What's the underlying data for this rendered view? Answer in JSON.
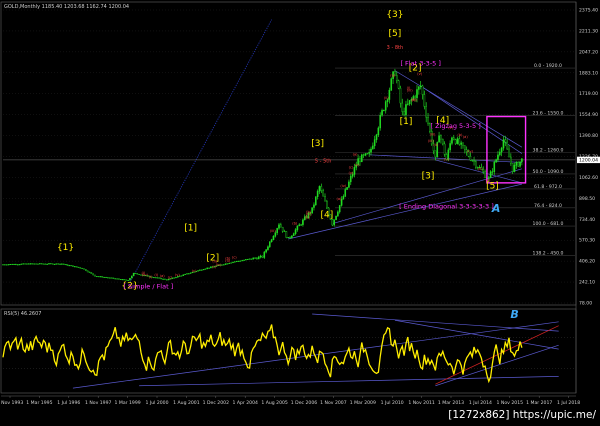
{
  "header": "GOLD,Monthly  1185.40 1203.68 1162.74 1200.04",
  "rsi_label": "RSI(5) 46.2607",
  "watermark": "[1272x862]  https://upic.me/",
  "colors": {
    "background": "#000000",
    "candles": "#22dd22",
    "rsi": "#ffee00",
    "grid": "#2a2a2a",
    "fib": "#3a3a3a",
    "trendline": "#5a5ad0",
    "box": "#ff33ff",
    "wave_major": "#ffee00",
    "wave_minor": "#ff4444",
    "wave_magenta": "#ff33ff",
    "wave_cyan": "#3fa9f5"
  },
  "chart_data": [
    {
      "type": "candlestick",
      "title": "GOLD,Monthly",
      "last_bar": {
        "open": 1185.4,
        "high": 1203.68,
        "low": 1162.74,
        "close": 1200.04
      },
      "current_price_label": "1200.04",
      "y_ticks": [
        "2375.40",
        "2211.30",
        "2047.20",
        "1883.10",
        "1719.00",
        "1554.90",
        "1390.80",
        "1226.70",
        "1062.60",
        "898.50",
        "734.40",
        "570.30",
        "406.20",
        "242.10",
        "78.00"
      ],
      "fib_levels": [
        {
          "label": "0.0 - 1920.0",
          "value": 1920
        },
        {
          "label": "23.6 - 1550.0",
          "value": 1550
        },
        {
          "label": "38.2 - 1260.0",
          "value": 1260
        },
        {
          "label": "50.0 - 1090.0",
          "value": 1090
        },
        {
          "label": "61.8 - 972.0",
          "value": 972
        },
        {
          "label": "76.4 - 824.0",
          "value": 824
        },
        {
          "label": "100.0 - 681.0",
          "value": 681
        },
        {
          "label": "138.2 - 450.0",
          "value": 450
        }
      ],
      "x_labels": [
        "1 Nov 1993",
        "1 Mar 1995",
        "1 Jul 1996",
        "1 Nov 1997",
        "1 Mar 1999",
        "1 Jul 2000",
        "1 Aug 2001",
        "1 Dec 2002",
        "1 Apr 2004",
        "1 Aug 2005",
        "1 Dec 2006",
        "1 Nov 2007",
        "1 Mar 2009",
        "1 Jul 2010",
        "1 Nov 2011",
        "1 Mar 2013",
        "1 Jul 2014",
        "1 Nov 2015",
        "1 Mar 2017",
        "1 Jul 2018"
      ],
      "series": [
        {
          "name": "GOLD",
          "anchors": [
            {
              "date": "1993-11",
              "value": 380
            },
            {
              "date": "1995-03",
              "value": 385
            },
            {
              "date": "1996-07",
              "value": 385
            },
            {
              "date": "1997-06",
              "value": 350
            },
            {
              "date": "1998-01",
              "value": 290
            },
            {
              "date": "1999-07",
              "value": 255
            },
            {
              "date": "1999-10",
              "value": 310
            },
            {
              "date": "2001-04",
              "value": 260
            },
            {
              "date": "2002-12",
              "value": 345
            },
            {
              "date": "2004-04",
              "value": 400
            },
            {
              "date": "2005-08",
              "value": 440
            },
            {
              "date": "2006-05",
              "value": 700
            },
            {
              "date": "2006-10",
              "value": 580
            },
            {
              "date": "2007-11",
              "value": 810
            },
            {
              "date": "2008-03",
              "value": 990
            },
            {
              "date": "2008-10",
              "value": 700
            },
            {
              "date": "2009-12",
              "value": 1200
            },
            {
              "date": "2010-06",
              "value": 1240
            },
            {
              "date": "2011-08",
              "value": 1900
            },
            {
              "date": "2011-12",
              "value": 1560
            },
            {
              "date": "2012-10",
              "value": 1780
            },
            {
              "date": "2013-06",
              "value": 1200
            },
            {
              "date": "2013-08",
              "value": 1420
            },
            {
              "date": "2013-12",
              "value": 1200
            },
            {
              "date": "2014-03",
              "value": 1390
            },
            {
              "date": "2015-11",
              "value": 1050
            },
            {
              "date": "2016-07",
              "value": 1360
            },
            {
              "date": "2016-12",
              "value": 1130
            },
            {
              "date": "2017-05",
              "value": 1200
            }
          ]
        }
      ]
    },
    {
      "type": "line",
      "title": "RSI(5) 46.2607",
      "ylim": [
        0,
        100
      ],
      "levels": [
        70,
        30
      ],
      "series": [
        {
          "name": "RSI(5)"
        }
      ]
    }
  ],
  "annotations": {
    "major": [
      {
        "text": "{3}",
        "date": "2011-08",
        "value": 2320
      },
      {
        "text": "[5]",
        "date": "2011-08",
        "value": 2170
      },
      {
        "text": "{1}",
        "date": "1996-09",
        "value": 495
      },
      {
        "text": "{2}",
        "date": "1999-08",
        "value": 190
      },
      {
        "text": "[1]",
        "date": "2002-05",
        "value": 645
      },
      {
        "text": "[2]",
        "date": "2003-05",
        "value": 410
      },
      {
        "text": "[3]",
        "date": "2008-02",
        "value": 1310
      },
      {
        "text": "[4]",
        "date": "2008-07",
        "value": 750
      },
      {
        "text": "[1]",
        "date": "2012-02",
        "value": 1480
      },
      {
        "text": "[2]",
        "date": "2012-07",
        "value": 1900
      },
      {
        "text": "[4]",
        "date": "2013-10",
        "value": 1490
      },
      {
        "text": "[3]",
        "date": "2013-02",
        "value": 1055
      },
      {
        "text": "[5]",
        "date": "2016-01",
        "value": 975
      }
    ],
    "magenta": [
      {
        "text": "[ Flat 3-3-5 ]",
        "date": "2012-10",
        "value": 1940
      },
      {
        "text": "[ Zigzag 5-3-5 ]",
        "date": "2014-05",
        "value": 1450
      },
      {
        "text": "[ Ending Diagonal 3-3-3-3-3 ]",
        "date": "2013-12",
        "value": 820
      },
      {
        "text": "[ Simple / Flat ]",
        "date": "2000-06",
        "value": 190
      }
    ],
    "red": [
      {
        "text": "3 - 8th",
        "date": "2011-08",
        "value": 2070
      },
      {
        "text": "5 - 5th",
        "date": "2008-05",
        "value": 1180
      }
    ],
    "cyan": [
      {
        "text": "A",
        "date": "2016-03",
        "value": 790
      },
      {
        "text": "B",
        "date": "2017-01",
        "value": 0
      }
    ]
  }
}
